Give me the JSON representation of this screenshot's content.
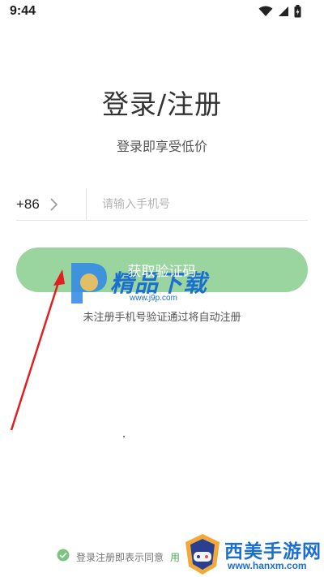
{
  "status_bar": {
    "time": "9:44",
    "icons": [
      "wifi-icon",
      "signal-icon",
      "battery-icon"
    ]
  },
  "login": {
    "title": "登录/注册",
    "subtitle": "登录即享受低价",
    "country_code": "+86",
    "phone_placeholder": "请输入手机号",
    "phone_value": "",
    "get_code_label": "获取验证码",
    "auto_register_note": "未注册手机号验证通过将自动注册",
    "agreement_prefix": "登录注册即表示同意",
    "agreement_link": "用"
  },
  "watermarks": {
    "top_name": "精品下载",
    "top_url": "www.j9p.com",
    "bottom_name": "西美手游网",
    "bottom_url": "www.hanxm.com"
  },
  "colors": {
    "button_green": "#9ad49f",
    "check_green": "#7cc481",
    "link_green": "#4caf50",
    "arrow_red": "#e02020",
    "watermark_blue": "#1b6fd1"
  }
}
